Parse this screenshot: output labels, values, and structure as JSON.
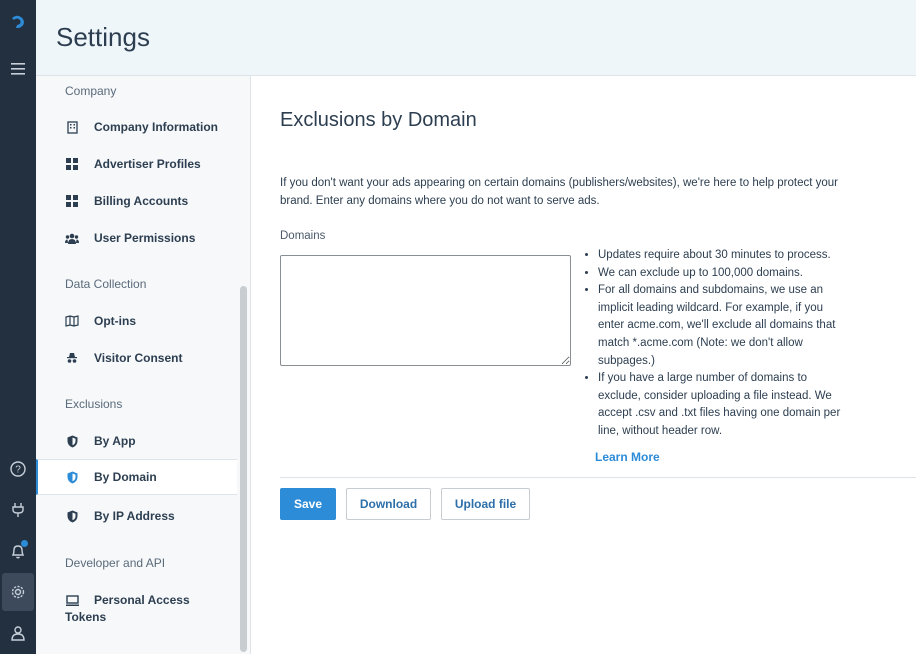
{
  "app": {
    "accent_color": "#2d8cd8",
    "rail_color": "#233040",
    "rail_icons": [
      "logo-icon",
      "menu-icon",
      "help-icon",
      "plug-icon",
      "bell-icon",
      "gear-icon",
      "user-icon"
    ]
  },
  "header": {
    "title": "Settings"
  },
  "nav": {
    "sections": [
      {
        "label": "Company"
      },
      {
        "label": "Data Collection"
      },
      {
        "label": "Exclusions"
      },
      {
        "label": "Developer and API"
      }
    ],
    "items": [
      {
        "label": "Company Information",
        "icon": "building-icon"
      },
      {
        "label": "Advertiser Profiles",
        "icon": "grid-icon"
      },
      {
        "label": "Billing Accounts",
        "icon": "grid-icon"
      },
      {
        "label": "User Permissions",
        "icon": "users-icon"
      },
      {
        "label": "Opt-ins",
        "icon": "map-icon"
      },
      {
        "label": "Visitor Consent",
        "icon": "incognito-icon"
      },
      {
        "label": "By App",
        "icon": "shield-icon"
      },
      {
        "label": "By Domain",
        "icon": "shield-icon",
        "active": true
      },
      {
        "label": "By IP Address",
        "icon": "shield-icon"
      },
      {
        "label": "Personal Access Tokens",
        "icon": "token-icon"
      }
    ]
  },
  "main": {
    "title": "Exclusions by Domain",
    "intro": "If you don't want your ads appearing on certain domains (publishers/websites), we're here to help protect your brand. Enter any domains where you do not want to serve ads.",
    "domains_label": "Domains",
    "domains_value": "",
    "notes": [
      "Updates require about 30 minutes to process.",
      "We can exclude up to 100,000 domains.",
      "For all domains and subdomains, we use an implicit leading wildcard. For example, if you enter acme.com, we'll exclude all domains that match *.acme.com (Note: we don't allow subpages.)",
      "If you have a large number of domains to exclude, consider uploading a file instead. We accept .csv and .txt files having one domain per line, without header row."
    ],
    "learn_more": "Learn More",
    "buttons": {
      "save": "Save",
      "download": "Download",
      "upload": "Upload file"
    }
  }
}
